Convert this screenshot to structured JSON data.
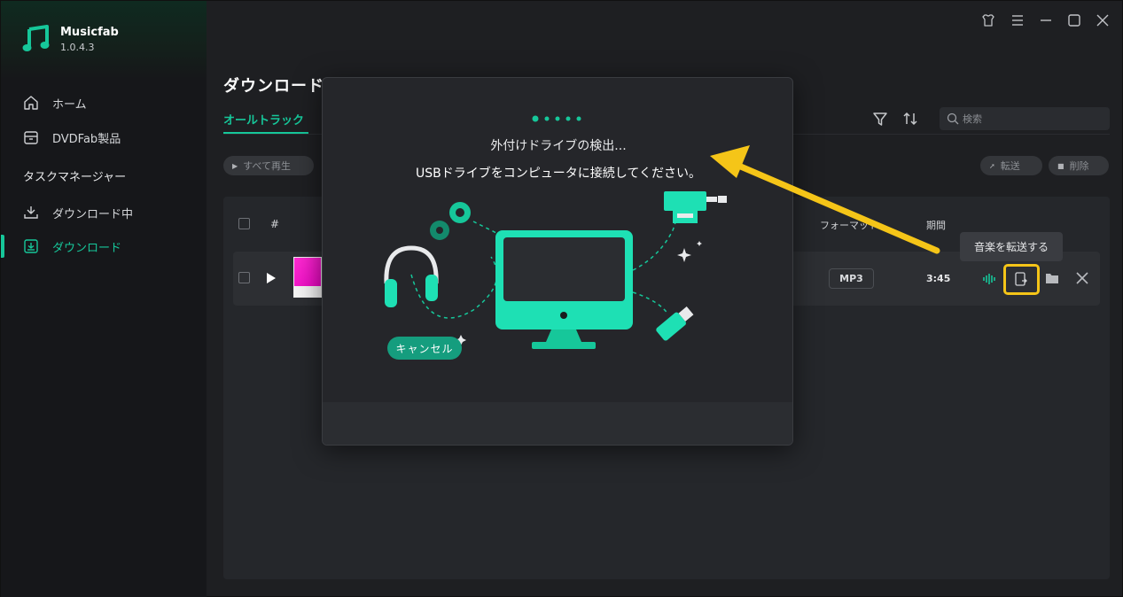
{
  "app": {
    "name": "Musicfab",
    "version": "1.0.4.3"
  },
  "sidebar": {
    "home": "ホーム",
    "dvdfab": "DVDFab製品",
    "section_title": "タスクマネージャー",
    "downloading": "ダウンロード中",
    "downloaded": "ダウンロード"
  },
  "main": {
    "title": "ダウンロード",
    "tab_all": "オールトラック",
    "search_placeholder": "検索",
    "play_all": "すべて再生",
    "transfer": "転送",
    "delete": "削除",
    "columns": {
      "index": "#",
      "format": "フォーマット",
      "duration": "期間"
    },
    "track": {
      "format": "MP3",
      "duration": "3:45"
    },
    "tooltip": "音楽を転送する"
  },
  "modal": {
    "line1": "外付けドライブの検出...",
    "line2": "USBドライブをコンピュータに接続してください。",
    "cancel": "キャンセル"
  },
  "colors": {
    "accent": "#16c79a",
    "highlight": "#f5c518",
    "background": "#1e1f22"
  },
  "icons": [
    "logo-icon",
    "home-icon",
    "box-icon",
    "download-arrow-icon",
    "download-box-icon",
    "shirt-icon",
    "menu-icon",
    "minimize-icon",
    "maximize-icon",
    "close-icon",
    "filter-icon",
    "sort-icon",
    "search-icon",
    "play-icon",
    "waveform-icon",
    "transfer-icon",
    "folder-icon",
    "remove-icon"
  ]
}
